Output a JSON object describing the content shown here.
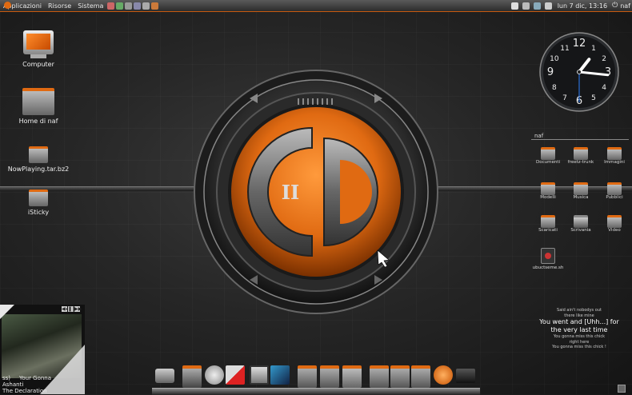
{
  "top_panel": {
    "menus": [
      "Applicazioni",
      "Risorse",
      "Sistema"
    ],
    "clock": "lun  7 dic, 13:16",
    "user": "naf"
  },
  "desktop_icons": [
    {
      "label": "Computer",
      "icon": "monitor-icon"
    },
    {
      "label": "Home di naf",
      "icon": "home-folder-icon"
    },
    {
      "label": "NowPlaying.tar.bz2",
      "icon": "archive-icon"
    },
    {
      "label": "iSticky",
      "icon": "folder-icon"
    }
  ],
  "emblem": {
    "glyph": "II"
  },
  "clock_widget": {
    "numerals": [
      "12",
      "1",
      "2",
      "3",
      "4",
      "5",
      "6",
      "7",
      "8",
      "9",
      "10",
      "11"
    ],
    "hour": 1,
    "minute": 16,
    "second": 30
  },
  "file_grid": {
    "title": "naf",
    "items": [
      {
        "label": "Documenti"
      },
      {
        "label": "freetz-trunk"
      },
      {
        "label": "Immagini"
      },
      {
        "label": "Modelli"
      },
      {
        "label": "Musica"
      },
      {
        "label": "Pubblici"
      },
      {
        "label": "Scaricati"
      },
      {
        "label": "Scrivania"
      },
      {
        "label": "Video"
      },
      {
        "label": "ubuctseme.sh"
      }
    ]
  },
  "lyrics": {
    "lines_small_top": [
      "Said ain't nobodys out",
      "there like mine"
    ],
    "lines_big": [
      "You went and [Uhh...] for",
      "the very last time"
    ],
    "lines_small_bottom": [
      "You gonna miss this chick",
      "right here",
      "You gonna miss this chick !"
    ]
  },
  "player": {
    "track": "Your Gonna",
    "prefix": "ss)",
    "artist": "Ashanti",
    "album": "The Declaration",
    "controls": [
      "◀◀",
      "❚❚",
      "▶▶"
    ]
  },
  "colors": {
    "accent": "#e06a12"
  }
}
